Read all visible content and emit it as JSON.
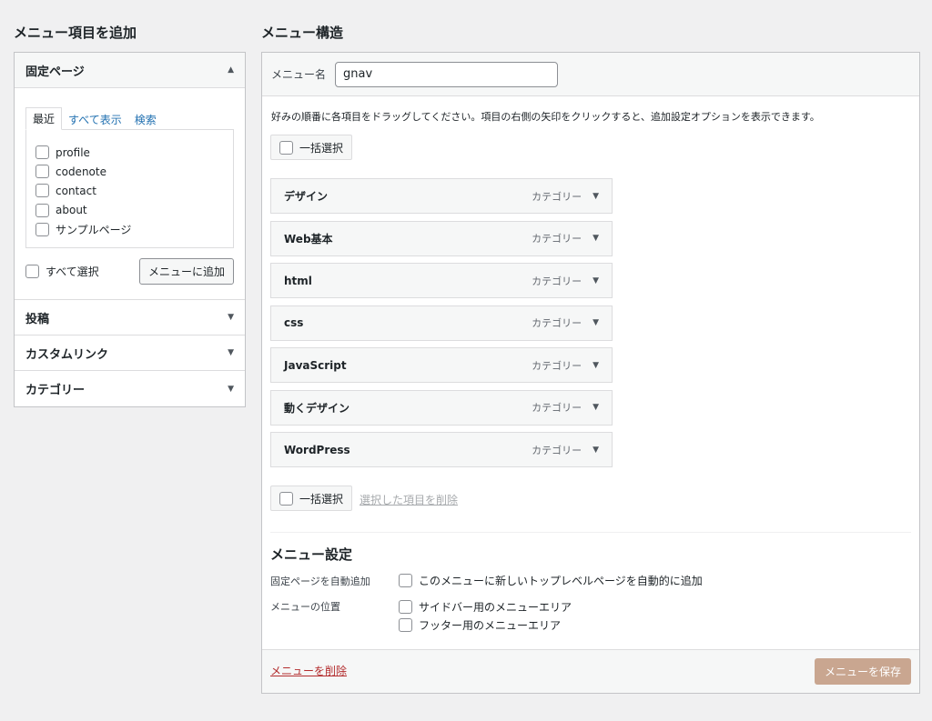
{
  "left": {
    "heading": "メニュー項目を追加",
    "panels": {
      "pages": {
        "title": "固定ページ",
        "open": true
      },
      "posts": {
        "title": "投稿"
      },
      "custom_links": {
        "title": "カスタムリンク"
      },
      "categories": {
        "title": "カテゴリー"
      }
    },
    "tabs": {
      "recent": "最近",
      "all": "すべて表示",
      "search": "検索"
    },
    "pages_list": [
      "profile",
      "codenote",
      "contact",
      "about",
      "サンプルページ"
    ],
    "select_all": "すべて選択",
    "add_button": "メニューに追加"
  },
  "right": {
    "heading": "メニュー構造",
    "menu_name_label": "メニュー名",
    "menu_name_value": "gnav",
    "instructions": "好みの順番に各項目をドラッグしてください。項目の右側の矢印をクリックすると、追加設定オプションを表示できます。",
    "bulk_select": "一括選択",
    "items": [
      {
        "title": "デザイン",
        "type": "カテゴリー"
      },
      {
        "title": "Web基本",
        "type": "カテゴリー"
      },
      {
        "title": "html",
        "type": "カテゴリー"
      },
      {
        "title": "css",
        "type": "カテゴリー"
      },
      {
        "title": "JavaScript",
        "type": "カテゴリー"
      },
      {
        "title": "動くデザイン",
        "type": "カテゴリー"
      },
      {
        "title": "WordPress",
        "type": "カテゴリー"
      }
    ],
    "remove_selected": "選択した項目を削除",
    "settings": {
      "title": "メニュー設定",
      "auto_add_label": "固定ページを自動追加",
      "auto_add_option": "このメニューに新しいトップレベルページを自動的に追加",
      "location_label": "メニューの位置",
      "locations": [
        "サイドバー用のメニューエリア",
        "フッター用のメニューエリア"
      ]
    },
    "delete_menu": "メニューを削除",
    "save_button": "メニューを保存"
  },
  "colors": {
    "accent_link": "#2271b1",
    "save_button": "#c9a690",
    "delete_link": "#b32d2e"
  }
}
